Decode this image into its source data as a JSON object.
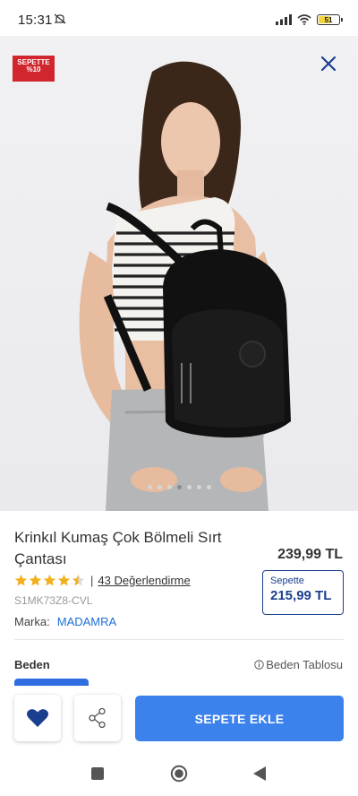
{
  "status_bar": {
    "time": "15:31",
    "battery": "51"
  },
  "hero": {
    "badge_line1": "SEPETTE",
    "badge_line2": "%10",
    "dot_count": 7,
    "active_dot": 3
  },
  "product": {
    "title": "Krinkıl Kumaş Çok Bölmeli Sırt Çantası",
    "price": "239,99 TL",
    "rating": 4.5,
    "rating_separator": "|",
    "reviews": "43 Değerlendirme",
    "sku": "S1MK73Z8-CVL",
    "brand_label": "Marka:",
    "brand_name": "MADAMRA"
  },
  "cart_price": {
    "label": "Sepette",
    "price": "215,99 TL"
  },
  "size": {
    "label": "Beden",
    "table_link": "Beden Tablosu"
  },
  "actions": {
    "add_to_cart": "SEPETE EKLE"
  },
  "colors": {
    "accent": "#3b82ec",
    "navy": "#1b3f8f",
    "brand_link": "#1b6fd6",
    "badge": "#d1262e",
    "heart": "#1b3f8f",
    "star": "#f2b01e"
  },
  "icons": {
    "close": "close-icon",
    "heart": "heart-icon",
    "share": "share-icon",
    "info": "info-icon"
  }
}
